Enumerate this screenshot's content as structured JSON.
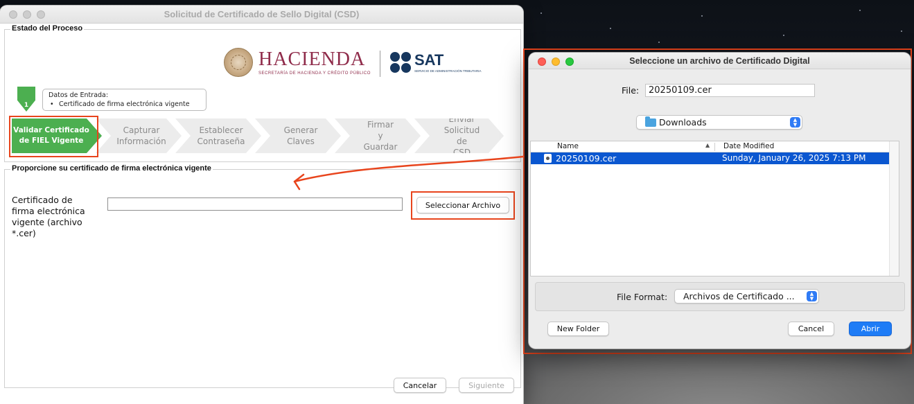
{
  "main_window": {
    "title": "Solicitud de Certificado de Sello Digital (CSD)",
    "section_estado": "Estado del Proceso",
    "logos": {
      "hacienda": "HACIENDA",
      "hacienda_sub": "SECRETARÍA DE HACIENDA Y CRÉDITO PÚBLICO",
      "sat": "SAT",
      "sat_sub": "SERVICIO DE ADMINISTRACIÓN TRIBUTARIA"
    },
    "step_number": "1",
    "entrada": {
      "title": "Datos de Entrada:",
      "item": "Certificado de firma electrónica vigente"
    },
    "steps": [
      {
        "line1": "Validar Certificado",
        "line2": "de FIEL Vigente",
        "line3": ""
      },
      {
        "line1": "Capturar",
        "line2": "Información",
        "line3": ""
      },
      {
        "line1": "Establecer",
        "line2": "Contraseña",
        "line3": ""
      },
      {
        "line1": "Generar",
        "line2": "Claves",
        "line3": ""
      },
      {
        "line1": "Firmar y",
        "line2": "Guardar",
        "line3": ""
      },
      {
        "line1": "Enviar",
        "line2": "Solicitud de",
        "line3": "CSD"
      }
    ],
    "section_proporcione": "Proporcione su certificado de firma electrónica vigente",
    "cert_label": "Certificado de firma electrónica vigente (archivo *.cer)",
    "cert_value": "",
    "select_button": "Seleccionar Archivo",
    "cancel_button": "Cancelar",
    "next_button": "Siguiente"
  },
  "dialog": {
    "title": "Seleccione un archivo de Certificado Digital",
    "file_label": "File:",
    "file_value": "20250109.cer",
    "folder": "Downloads",
    "columns": {
      "name": "Name",
      "date": "Date Modified"
    },
    "files": [
      {
        "name": "20250109.cer",
        "date": "Sunday, January 26, 2025 7:13 PM",
        "selected": true
      }
    ],
    "format_label": "File Format:",
    "format_value": "Archivos de Certificado ...",
    "new_folder_button": "New Folder",
    "cancel_button": "Cancel",
    "open_button": "Abrir"
  },
  "colors": {
    "active_step": "#4caf50",
    "highlight": "#e8441c",
    "selection": "#0b57d0",
    "hacienda": "#8f2b4a",
    "sat": "#17375e"
  }
}
